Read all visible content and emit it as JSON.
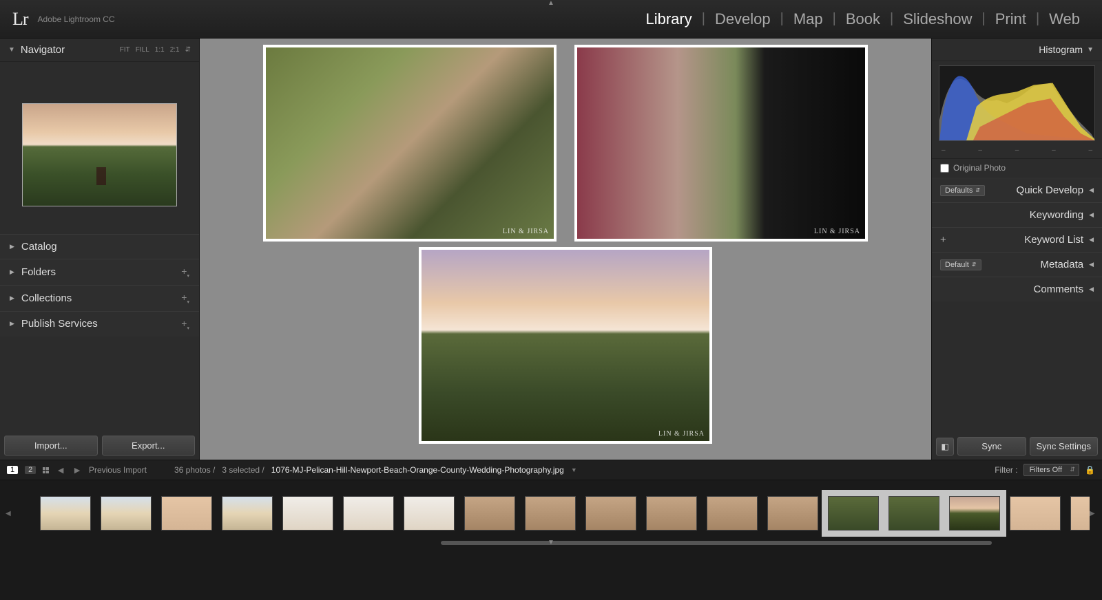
{
  "app": {
    "logo": "Lr",
    "title": "Adobe Lightroom CC"
  },
  "modules": [
    "Library",
    "Develop",
    "Map",
    "Book",
    "Slideshow",
    "Print",
    "Web"
  ],
  "active_module": "Library",
  "left_panel": {
    "navigator": {
      "title": "Navigator",
      "zoom_opts": [
        "FIT",
        "FILL",
        "1:1",
        "2:1"
      ]
    },
    "sections": [
      {
        "label": "Catalog",
        "plus": false
      },
      {
        "label": "Folders",
        "plus": true
      },
      {
        "label": "Collections",
        "plus": true
      },
      {
        "label": "Publish Services",
        "plus": true
      }
    ],
    "import_btn": "Import...",
    "export_btn": "Export..."
  },
  "center": {
    "watermark": "LIN & JIRSA"
  },
  "right_panel": {
    "histogram_title": "Histogram",
    "original_photo": "Original Photo",
    "sections": [
      {
        "dropdown": "Defaults",
        "label": "Quick Develop"
      },
      {
        "label": "Keywording"
      },
      {
        "plus": true,
        "label": "Keyword List"
      },
      {
        "dropdown": "Default",
        "label": "Metadata"
      },
      {
        "label": "Comments"
      }
    ],
    "sync_btn": "Sync",
    "sync_settings_btn": "Sync Settings"
  },
  "toolbar": {
    "window_1": "1",
    "window_2": "2",
    "source": "Previous Import",
    "count": "36 photos /",
    "selected": "3 selected /",
    "filename": "1076-MJ-Pelican-Hill-Newport-Beach-Orange-County-Wedding-Photography.jpg",
    "filter_label": "Filter :",
    "filter_value": "Filters Off"
  },
  "filmstrip": {
    "thumbs": [
      {
        "cls": "ft-venue"
      },
      {
        "cls": "ft-venue"
      },
      {
        "cls": "ft-indoor"
      },
      {
        "cls": "ft-venue"
      },
      {
        "cls": "ft-white"
      },
      {
        "cls": "ft-white"
      },
      {
        "cls": "ft-white"
      },
      {
        "cls": "ft-recept"
      },
      {
        "cls": "ft-recept"
      },
      {
        "cls": "ft-recept"
      },
      {
        "cls": "ft-recept"
      },
      {
        "cls": "ft-recept"
      },
      {
        "cls": "ft-recept"
      },
      {
        "cls": "ft-outdoor",
        "sel": true
      },
      {
        "cls": "ft-outdoor",
        "sel": true
      },
      {
        "cls": "ft-sunset",
        "sel": true
      },
      {
        "cls": "ft-indoor"
      },
      {
        "cls": "ft-indoor"
      },
      {
        "cls": "ft-indoor"
      }
    ]
  }
}
